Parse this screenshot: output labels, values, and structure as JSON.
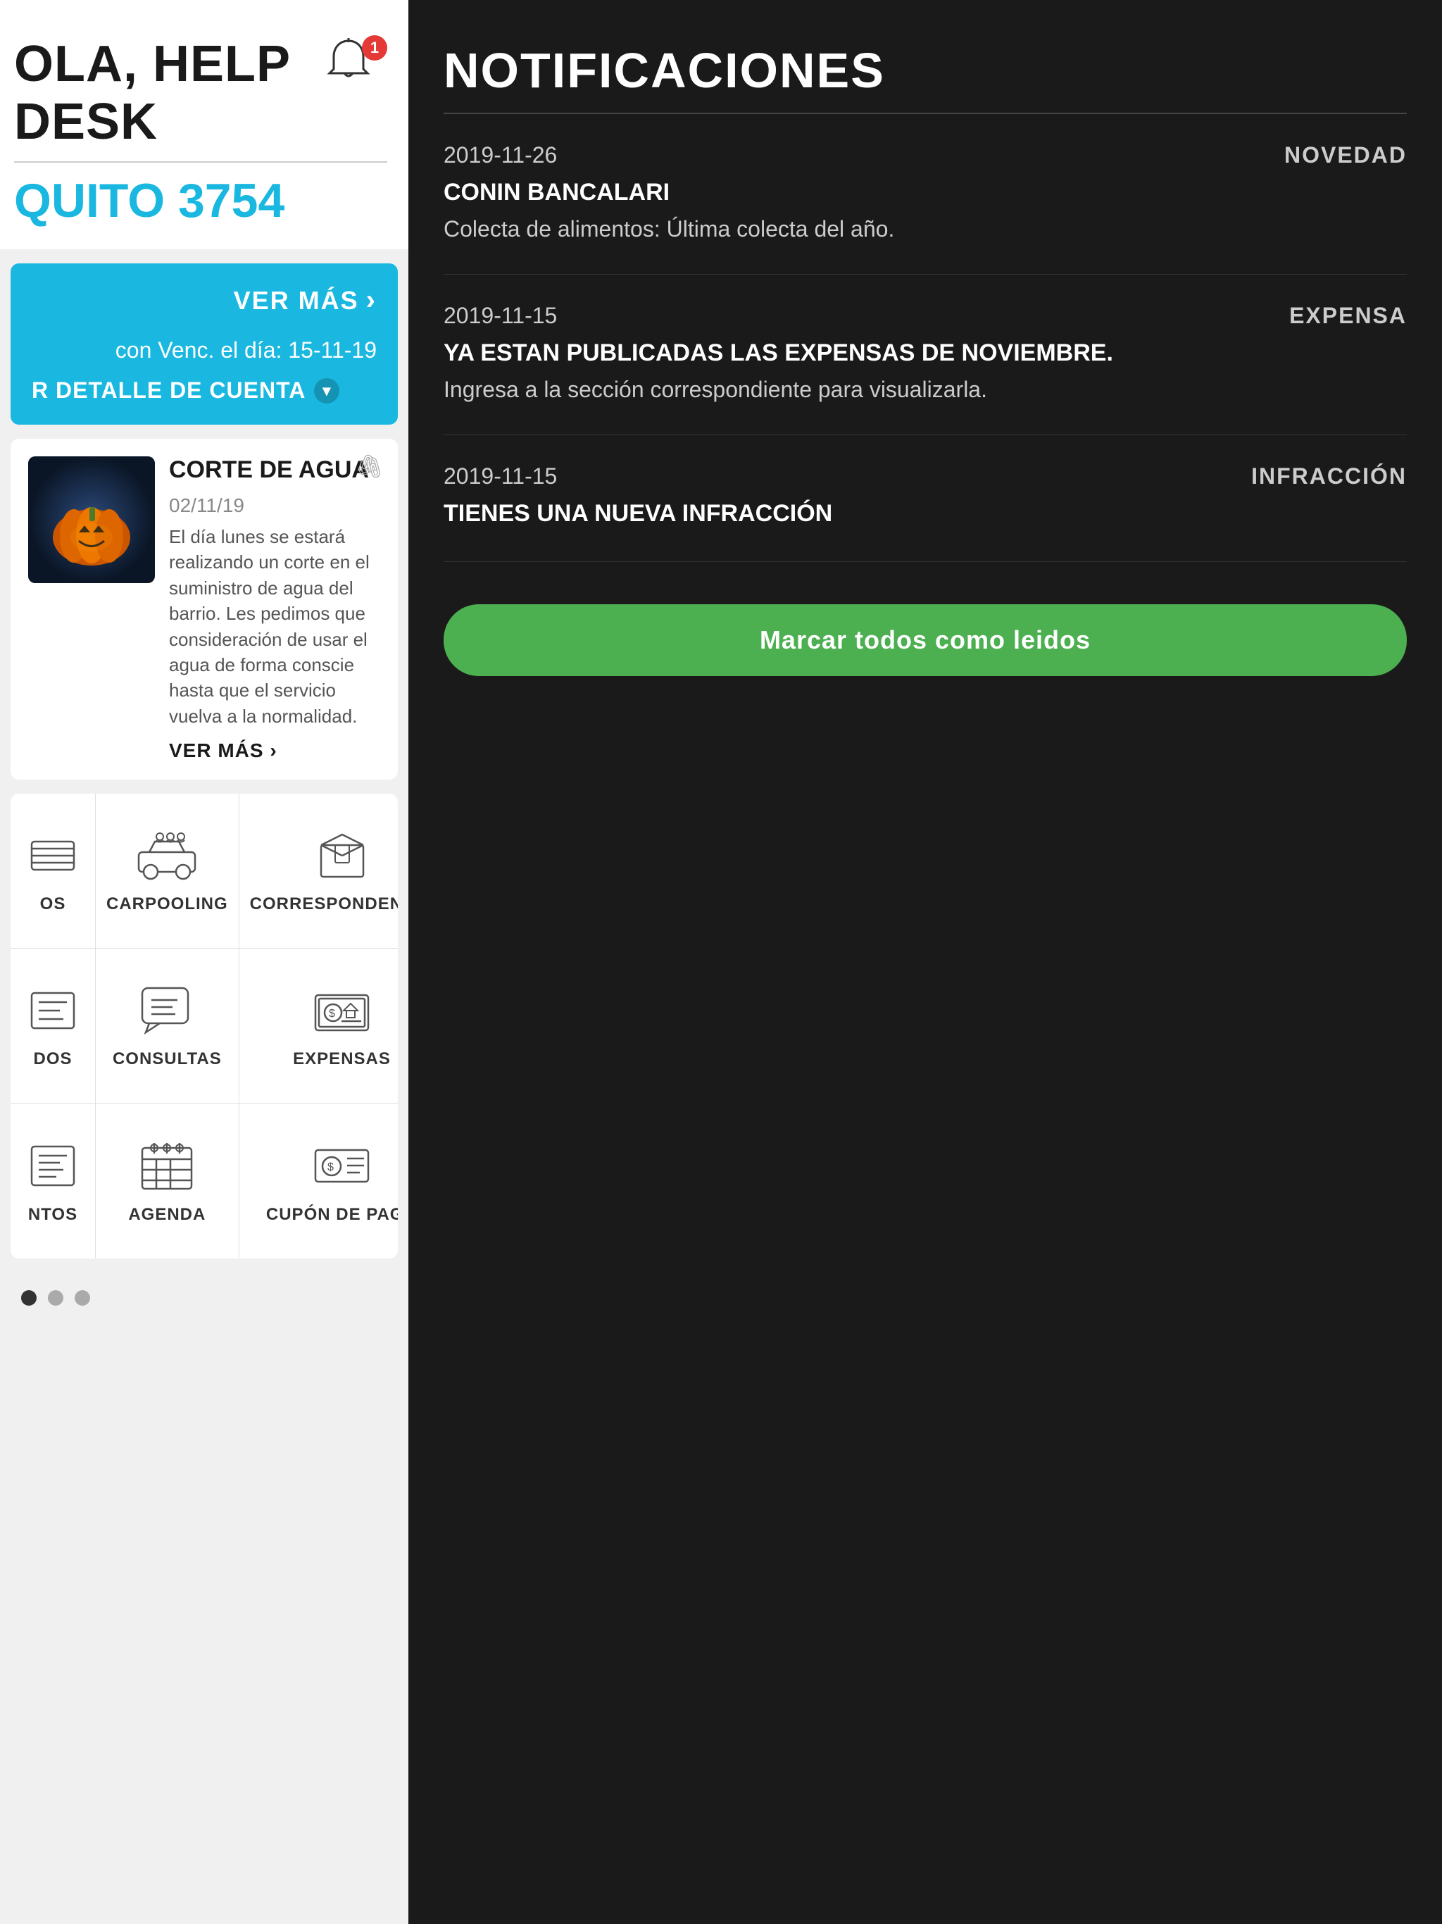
{
  "left": {
    "title": "OLA, HELP DESK",
    "apartment": "QUITO 3754",
    "bell": {
      "badge": "1"
    },
    "blue_card": {
      "ver_mas": "VER MÁS",
      "vencimiento": "con Venc. el día: 15-11-19",
      "detalle": "R DETALLE DE CUENTA"
    },
    "news": {
      "attachment_icon": "📎",
      "title": "CORTE DE AGUA",
      "date": "02/11/19",
      "body": "El día lunes se estará realizando un corte en el suministro de agua del barrio. Les pedimos que consideración de usar el agua de forma conscie hasta que el servicio vuelva a la normalidad.",
      "ver_mas": "VER MÁS"
    },
    "grid": {
      "items": [
        {
          "label": "OS",
          "icon": "left_partial"
        },
        {
          "label": "CARPOOLING",
          "icon": "carpooling"
        },
        {
          "label": "CORRESPONDENCIA",
          "icon": "box"
        },
        {
          "label": "DOS",
          "icon": "left_partial2"
        },
        {
          "label": "CONSULTAS",
          "icon": "consultas"
        },
        {
          "label": "EXPENSAS",
          "icon": "expensas"
        },
        {
          "label": "NTOS",
          "icon": "left_partial3"
        },
        {
          "label": "AGENDA",
          "icon": "agenda"
        },
        {
          "label": "CUPÓN DE PAGO",
          "icon": "coupon"
        }
      ]
    },
    "pagination": {
      "active": 0,
      "total": 3
    }
  },
  "right": {
    "title": "NOTIFICACIONES",
    "notifications": [
      {
        "date": "2019-11-26",
        "category": "NOVEDAD",
        "sender": "CONIN BANCALARI",
        "message": "Colecta de alimentos: Última colecta del año."
      },
      {
        "date": "2019-11-15",
        "category": "EXPENSA",
        "sender": "YA ESTAN PUBLICADAS LAS EXPENSAS DE NOVIEMBRE.",
        "message": "Ingresa a la sección correspondiente para visualizarla."
      },
      {
        "date": "2019-11-15",
        "category": "INFRACCIÓN",
        "sender": "TIENES UNA NUEVA INFRACCIÓN",
        "message": ""
      }
    ],
    "mark_all_btn": "Marcar todos como leidos"
  }
}
